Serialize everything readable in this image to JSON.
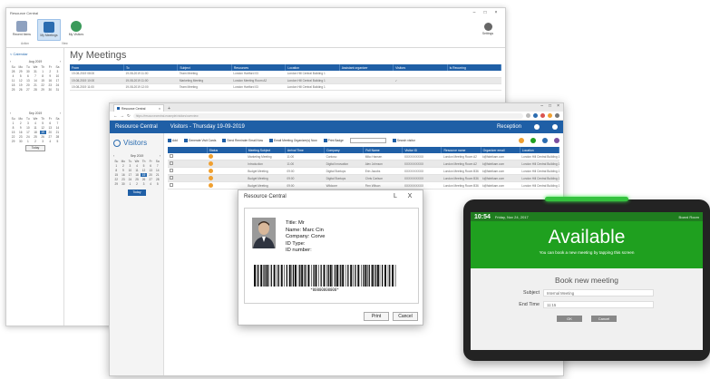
{
  "winA": {
    "title": "Resource Central",
    "ribbon": [
      {
        "label": "Recent Items",
        "icon": "calendar-grid-icon",
        "color": "#7a8fb0"
      },
      {
        "label": "My Meetings",
        "icon": "meetings-icon",
        "color": "#2b6cb0"
      },
      {
        "label": "My Visitors",
        "icon": "people-icon",
        "color": "#3a9a5a"
      }
    ],
    "ribbon_groups": [
      "Action",
      "View"
    ],
    "settings_label": "Settings",
    "calendar_link": "< Calendar",
    "page_title": "My Meetings",
    "cal1": {
      "month": "Aug 2019",
      "days": [
        "Su",
        "Mo",
        "Tu",
        "We",
        "Th",
        "Fr",
        "Sa",
        "28",
        "29",
        "30",
        "31",
        "1",
        "2",
        "3",
        "4",
        "5",
        "6",
        "7",
        "8",
        "9",
        "10",
        "11",
        "12",
        "13",
        "14",
        "15",
        "16",
        "17",
        "18",
        "19",
        "20",
        "21",
        "22",
        "23",
        "24",
        "25",
        "26",
        "27",
        "28",
        "29",
        "30",
        "31"
      ]
    },
    "cal2": {
      "month": "Sep 2019",
      "days": [
        "Su",
        "Mo",
        "Tu",
        "We",
        "Th",
        "Fr",
        "Sa",
        "1",
        "2",
        "3",
        "4",
        "5",
        "6",
        "7",
        "8",
        "9",
        "10",
        "11",
        "12",
        "13",
        "14",
        "15",
        "16",
        "17",
        "18",
        "19",
        "20",
        "21",
        "22",
        "23",
        "24",
        "25",
        "26",
        "27",
        "28",
        "29",
        "30",
        "1",
        "2",
        "3",
        "4",
        "5"
      ]
    },
    "today_btn": "Today",
    "columns": [
      "From",
      "To",
      "Subject",
      "Resources",
      "Location",
      "Assistant organizer",
      "Visitors",
      "Is Recurring"
    ],
    "rows": [
      [
        "19-08-2019 08:00",
        "19-08-2019 11:00",
        "Team Meeting",
        "London Hartford 03",
        "London Hill Central Building 1",
        "",
        "",
        ""
      ],
      [
        "19-08-2019 10:00",
        "19-08-2019 11:00",
        "Marketing Meeting",
        "London Meeting Room A2",
        "London Hill Central Building 1",
        "",
        "✓",
        ""
      ],
      [
        "19-08-2019 11:00",
        "19-08-2019 12:00",
        "Team Meeting",
        "London Hartford 03",
        "London Hill Central Building 1",
        "",
        "",
        ""
      ]
    ]
  },
  "winB": {
    "tab_title": "Resource Central",
    "url": "https://resourcecentral.example/visitors/overview",
    "app_name": "Resource Central",
    "page_header": "Visitors - Thursday 19-09-2019",
    "reception": "Reception",
    "side_title": "Visitors",
    "cal": {
      "month": "Sep 2019",
      "days": [
        "Su",
        "Mo",
        "Tu",
        "We",
        "Th",
        "Fr",
        "Sa",
        "1",
        "2",
        "3",
        "4",
        "5",
        "6",
        "7",
        "8",
        "9",
        "10",
        "11",
        "12",
        "13",
        "14",
        "15",
        "16",
        "17",
        "18",
        "19",
        "20",
        "21",
        "22",
        "23",
        "24",
        "25",
        "26",
        "27",
        "28",
        "29",
        "30",
        "1",
        "2",
        "3",
        "4",
        "5"
      ]
    },
    "today_btn": "Today",
    "toolbar": [
      "Add",
      "Generate Visit Cards",
      "Send Reminder Email Now",
      "Email Meeting Organizer(s) Now",
      "Print Badge"
    ],
    "search_label": "Search visitor",
    "status_colors": [
      "#f0a030",
      "#1fa01f",
      "#2b6cb0",
      "#7b4fa0"
    ],
    "columns": [
      "",
      "Status",
      "Meeting Subject",
      "Arrival Time",
      "Company",
      "Full Name",
      "Visitor ID",
      "Resource name",
      "Organizer email",
      "Location"
    ],
    "rows": [
      [
        "Marketing Meeting",
        "11:00",
        "Contoso",
        "Miko Hansen",
        "XXXXXXXXXX",
        "London Meeting Room A2",
        "k@fabrikam.com",
        "London Hill Central Building 1"
      ],
      [
        "Introduction",
        "11:00",
        "Digital Innovation",
        "Alex Johnson",
        "XXXXXXXXXX",
        "London Meeting Room A2",
        "k@fabrikam.com",
        "London Hill Central Building 1"
      ],
      [
        "Budget Meeting",
        "09:00",
        "Digital Startups",
        "Erin Jacobs",
        "XXXXXXXXXX",
        "London Meeting Room B36",
        "k@fabrikam.com",
        "London Hill Central Building 1"
      ],
      [
        "Budget Meeting",
        "09:00",
        "Digital Startups",
        "Chris Carlson",
        "XXXXXXXXXX",
        "London Meeting Room B36",
        "k@fabrikam.com",
        "London Hill Central Building 1"
      ],
      [
        "Budget Meeting",
        "09:00",
        "Wildcore",
        "Finn Wilson",
        "XXXXXXXXXX",
        "London Meeting Room B36",
        "k@fabrikam.com",
        "London Hill Central Building 1"
      ]
    ]
  },
  "dialog": {
    "title": "Resource Central",
    "min": "L",
    "close": "X",
    "fields": [
      "Title: Mr",
      "Name: Marc Cin",
      "Company: Corve",
      "ID Type:",
      "ID number:"
    ],
    "barcode_text": "*00000000000*",
    "print": "Print",
    "cancel": "Cancel"
  },
  "tablet": {
    "time": "10:54",
    "date": "Friday, Nov 24, 2017",
    "room": "Board Room",
    "status": "Available",
    "status_sub": "You can book a new meeting by tapping this screen",
    "book_title": "Book new meeting",
    "subject_label": "Subject",
    "subject_value": "Internal Meeting",
    "endtime_label": "End Time",
    "endtime_value": "11:15",
    "ok": "OK",
    "cancel": "Cancel",
    "green": "#1fa01f",
    "led": "#35c23f"
  }
}
